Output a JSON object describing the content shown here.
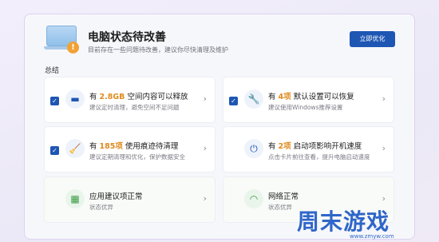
{
  "hero": {
    "title": "电脑状态待改善",
    "subtitle": "目前存在一些问题待改善，建议你尽快清理及维护",
    "optimize_label": "立即优化",
    "badge": "!"
  },
  "section": {
    "label": "总结"
  },
  "tiles": [
    {
      "checked": true,
      "icon": "disk-icon",
      "pre": "有",
      "highlight": "2.8GB",
      "post": "空间内容可以释放",
      "sub": "建议定时清理，避免空间不足问题"
    },
    {
      "checked": true,
      "icon": "wrench-icon",
      "pre": "有",
      "highlight": "4项",
      "post": "默认设置可以恢复",
      "sub": "建议使用Windows推荐设置"
    },
    {
      "checked": true,
      "icon": "broom-icon",
      "pre": "有",
      "highlight": "185项",
      "post": "使用痕迹待清理",
      "sub": "建议定期清理和优化，保护数据安全"
    },
    {
      "checked": false,
      "icon": "power-icon",
      "pre": "有",
      "highlight": "2项",
      "post": "启动项影响开机速度",
      "sub": "点击卡片前往查看，提升电脑启动速度"
    },
    {
      "checked": false,
      "icon": "apps-icon",
      "title": "应用建议项正常",
      "sub": "状态优异"
    },
    {
      "checked": false,
      "icon": "wifi-icon",
      "title": "网络正常",
      "sub": "状态优异"
    }
  ],
  "watermark": {
    "text": "周末游戏",
    "url": "www.zmyw.com"
  }
}
